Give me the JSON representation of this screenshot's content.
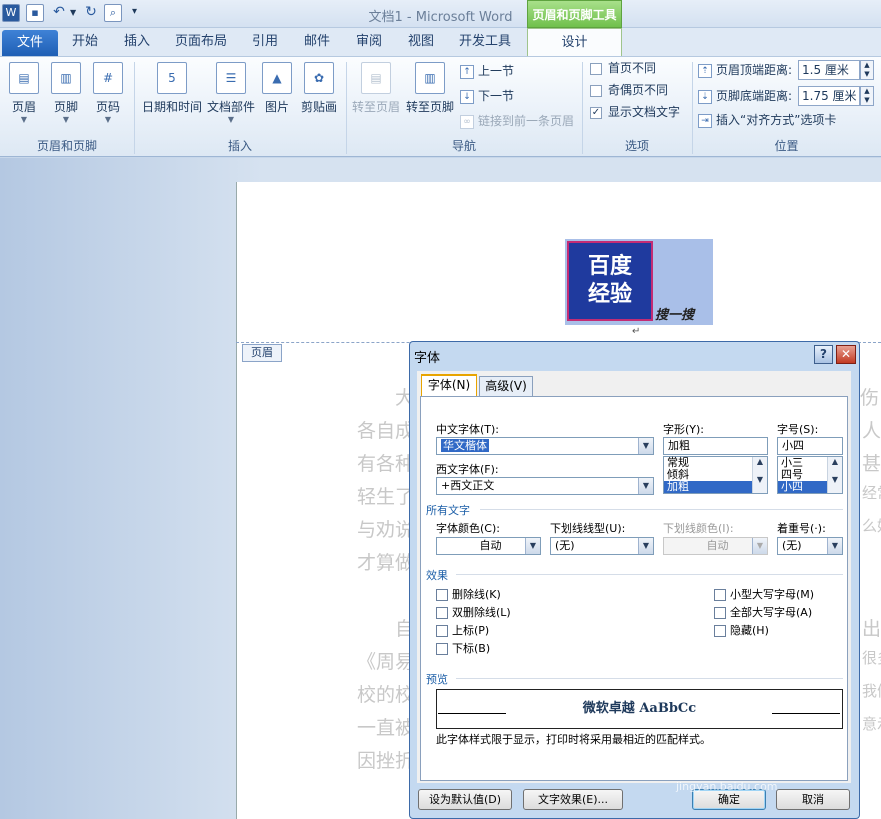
{
  "window": {
    "title": "文档1 - Microsoft Word",
    "context_tab_group": "页眉和页脚工具"
  },
  "tabs": [
    "文件",
    "开始",
    "插入",
    "页面布局",
    "引用",
    "邮件",
    "审阅",
    "视图",
    "开发工具",
    "设计"
  ],
  "ribbon": {
    "group1": {
      "label": "页眉和页脚",
      "buttons": [
        "页眉",
        "页脚",
        "页码"
      ]
    },
    "group2": {
      "label": "插入",
      "buttons": [
        "日期和时间",
        "文档部件",
        "图片",
        "剪贴画"
      ]
    },
    "group3": {
      "label": "导航",
      "buttons": [
        "转至页眉",
        "转至页脚"
      ],
      "small": [
        "上一节",
        "下一节",
        "链接到前一条页眉"
      ]
    },
    "group4": {
      "label": "选项",
      "checks": [
        "首页不同",
        "奇偶页不同",
        "显示文档文字"
      ],
      "checked": [
        false,
        false,
        true
      ]
    },
    "group5": {
      "label": "位置",
      "header_dist_label": "页眉顶端距离:",
      "header_dist_value": "1.5 厘米",
      "footer_dist_label": "页脚底端距离:",
      "footer_dist_value": "1.75 厘米",
      "align_tab": "插入“对齐方式”选项卡"
    }
  },
  "document": {
    "logo_line1": "百度",
    "logo_line2": "经验",
    "logo_caption": "搜一搜",
    "header_tag": "页眉",
    "body_left": [
      "大",
      "各自成",
      "有各种",
      "轻生了",
      "与劝说",
      "才算做",
      "自",
      "《周易",
      "校的校",
      "一直被",
      "因挫折"
    ],
    "body_right": [
      "伤",
      "人",
      "甚",
      "经常",
      "么好",
      "出",
      "很多",
      "我们",
      "意示"
    ]
  },
  "dialog": {
    "title": "字体",
    "help": "?",
    "close": "✕",
    "tabs": [
      "字体(N)",
      "高级(V)"
    ],
    "cn_font_label": "中文字体(T):",
    "cn_font_value": "华文楷体",
    "style_label": "字形(Y):",
    "style_value": "加粗",
    "style_options": [
      "常规",
      "倾斜",
      "加粗"
    ],
    "size_label": "字号(S):",
    "size_value": "小四",
    "size_options": [
      "小三",
      "四号",
      "小四"
    ],
    "west_font_label": "西文字体(F):",
    "west_font_value": "+西文正文",
    "all_text": "所有文字",
    "color_label": "字体颜色(C):",
    "color_value": "自动",
    "underline_label": "下划线线型(U):",
    "underline_value": "(无)",
    "underline_color_label": "下划线颜色(I):",
    "underline_color_value": "自动",
    "emphasis_label": "着重号(·):",
    "emphasis_value": "(无)",
    "effects": "效果",
    "effects_left": [
      "删除线(K)",
      "双删除线(L)",
      "上标(P)",
      "下标(B)"
    ],
    "effects_right": [
      "小型大写字母(M)",
      "全部大写字母(A)",
      "隐藏(H)"
    ],
    "preview_label": "预览",
    "preview_text": "微软卓越 AaBbCc",
    "preview_note": "此字体样式限于显示，打印时将采用最相近的匹配样式。",
    "btn_default": "设为默认值(D)",
    "btn_effects": "文字效果(E)...",
    "btn_ok": "确定",
    "btn_cancel": "取消"
  },
  "watermark": {
    "main": "Bai 经验",
    "sub": "jingyan.baidu.com"
  },
  "colors": {
    "file_tab": "#2b6fc6",
    "context_green": "#70c04c",
    "selection": "#3169c6"
  }
}
